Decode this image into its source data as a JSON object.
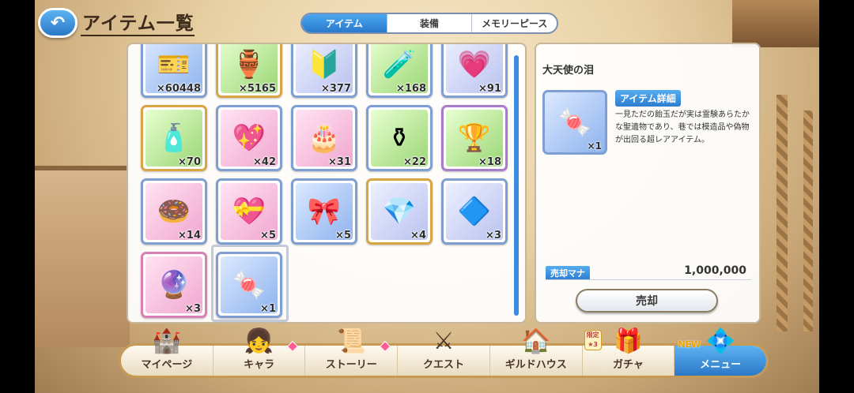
{
  "header": {
    "back_icon": "↶",
    "title": "アイテム一覧"
  },
  "tabs": [
    {
      "label": "アイテム",
      "active": true
    },
    {
      "label": "装備",
      "active": false
    },
    {
      "label": "メモリーピース",
      "active": false
    }
  ],
  "items": [
    {
      "count": "×60448",
      "icon": "ticket-icon",
      "glyph": "🎫",
      "bg": "blue",
      "frame": "blue"
    },
    {
      "count": "×5165",
      "icon": "urn-icon",
      "glyph": "🏺",
      "bg": "green",
      "frame": "gold"
    },
    {
      "count": "×377",
      "icon": "crest-icon",
      "glyph": "🔰",
      "bg": "lav",
      "frame": "blue"
    },
    {
      "count": "×168",
      "icon": "vial-icon",
      "glyph": "🧪",
      "bg": "green",
      "frame": "blue"
    },
    {
      "count": "×91",
      "icon": "heart-ornament-icon",
      "glyph": "💗",
      "bg": "lav",
      "frame": "blue"
    },
    {
      "count": "×70",
      "icon": "potion-icon",
      "glyph": "🧴",
      "bg": "green",
      "frame": "gold"
    },
    {
      "count": "×42",
      "icon": "heart-crystal-icon",
      "glyph": "💖",
      "bg": "pink",
      "frame": "blue"
    },
    {
      "count": "×31",
      "icon": "cake-icon",
      "glyph": "🎂",
      "bg": "pink",
      "frame": "blue"
    },
    {
      "count": "×22",
      "icon": "perfume-bottle-icon",
      "glyph": "⚱",
      "bg": "green",
      "frame": "blue"
    },
    {
      "count": "×18",
      "icon": "grail-icon",
      "glyph": "🏆",
      "bg": "green",
      "frame": "purple"
    },
    {
      "count": "×14",
      "icon": "donut-icon",
      "glyph": "🍩",
      "bg": "pink",
      "frame": "blue"
    },
    {
      "count": "×5",
      "icon": "heart-icon",
      "glyph": "💝",
      "bg": "pink",
      "frame": "blue"
    },
    {
      "count": "×5",
      "icon": "ribbon-card-icon",
      "glyph": "🎀",
      "bg": "blue",
      "frame": "blue"
    },
    {
      "count": "×4",
      "icon": "green-gem-icon",
      "glyph": "💎",
      "bg": "lav",
      "frame": "gold"
    },
    {
      "count": "×3",
      "icon": "blue-gem-icon",
      "glyph": "🔷",
      "bg": "lav",
      "frame": "blue"
    },
    {
      "count": "×3",
      "icon": "orb-icon",
      "glyph": "🔮",
      "bg": "pink",
      "frame": "pink"
    },
    {
      "count": "×1",
      "icon": "candy-icon",
      "glyph": "🍬",
      "bg": "blue",
      "frame": "blue"
    }
  ],
  "detail": {
    "name": "大天使の泪",
    "thumb_glyph": "🍬",
    "thumb_count": "×1",
    "badge": "アイテム詳細",
    "description": "一見ただの飴玉だが実は霊験あらたかな聖遺物であり、巷では模造品や偽物が出回る超レアアイテム。",
    "sell_label": "売却マナ",
    "sell_value": "1,000,000",
    "sell_button": "売却"
  },
  "nav": [
    {
      "label": "マイページ",
      "icon": "castle-icon",
      "glyph": "🏰",
      "badge": false
    },
    {
      "label": "キャラ",
      "icon": "character-icon",
      "glyph": "👧",
      "badge": true
    },
    {
      "label": "ストーリー",
      "icon": "scroll-icon",
      "glyph": "📜",
      "badge": true
    },
    {
      "label": "クエスト",
      "icon": "sword-flag-icon",
      "glyph": "⚔",
      "badge": false
    },
    {
      "label": "ギルドハウス",
      "icon": "house-icon",
      "glyph": "🏠",
      "badge": false
    },
    {
      "label": "ガチャ",
      "icon": "gacha-icon",
      "glyph": "🎁",
      "badge": false,
      "limited": "限定★3"
    },
    {
      "label": "メニュー",
      "icon": "crystal-icon",
      "glyph": "💠",
      "badge": false,
      "new": "NEW",
      "active": true
    }
  ]
}
